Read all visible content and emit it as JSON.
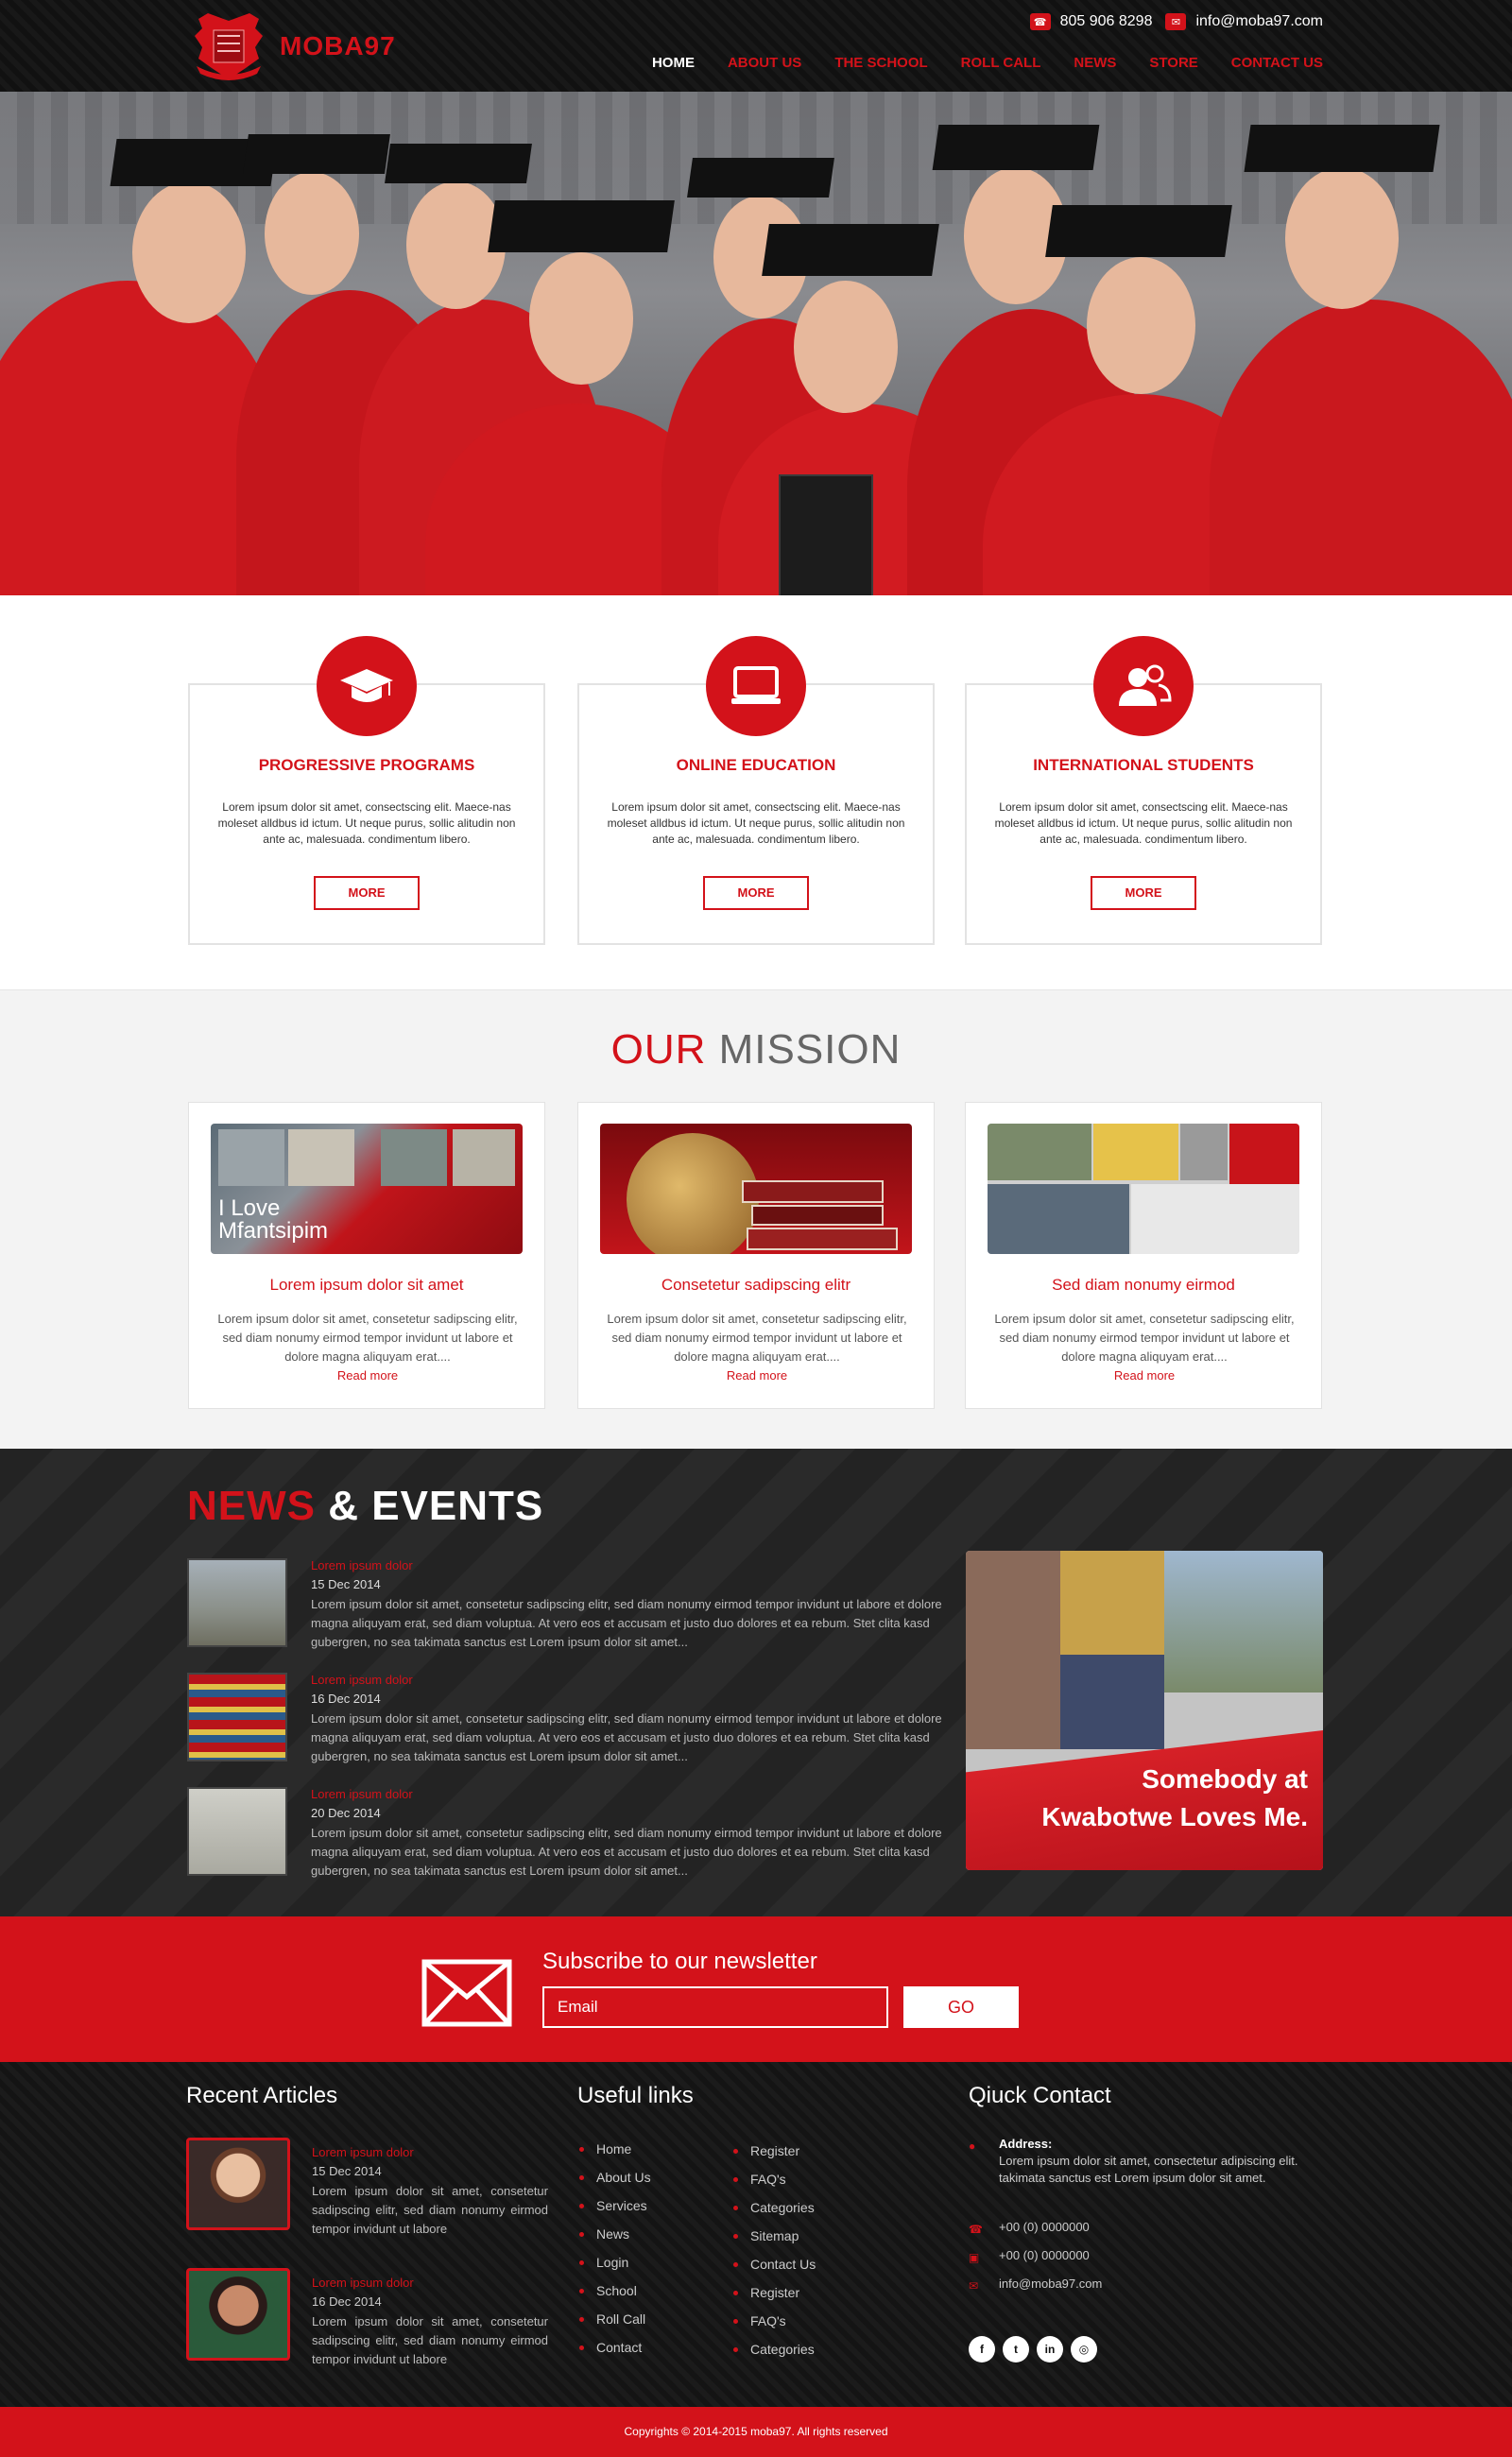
{
  "header": {
    "logo_text": "MOBA97",
    "phone": "805 906 8298",
    "email": "info@moba97.com",
    "nav": [
      "HOME",
      "ABOUT US",
      "THE SCHOOL",
      "ROLL CALL",
      "NEWS",
      "STORE",
      "CONTACT US"
    ],
    "active_nav": "HOME"
  },
  "features": [
    {
      "title": "PROGRESSIVE PROGRAMS",
      "icon": "graduation-cap-icon",
      "text": "Lorem ipsum dolor sit amet, consectscing elit. Maece-nas moleset alldbus id ictum. Ut neque purus, sollic alitudin non ante ac, malesuada. condimentum libero.",
      "button": "MORE"
    },
    {
      "title": "ONLINE EDUCATION",
      "icon": "monitor-icon",
      "text": "Lorem ipsum dolor sit amet, consectscing elit. Maece-nas moleset alldbus id ictum. Ut neque purus, sollic alitudin non ante ac, malesuada. condimentum libero.",
      "button": "MORE"
    },
    {
      "title": "INTERNATIONAL STUDENTS",
      "icon": "users-icon",
      "text": "Lorem ipsum dolor sit amet, consectscing elit. Maece-nas moleset alldbus id ictum. Ut neque purus, sollic alitudin non ante ac, malesuada. condimentum libero.",
      "button": "MORE"
    }
  ],
  "mission": {
    "title_red": "OUR",
    "title_rest": " MISSION",
    "cards": [
      {
        "image_caption": "I Love Mfantsipim",
        "title": "Lorem ipsum dolor sit amet",
        "text": "Lorem ipsum dolor sit amet, consetetur sadipscing elitr, sed diam nonumy eirmod tempor invidunt ut labore et dolore magna aliquyam erat....",
        "more": "Read more"
      },
      {
        "image_caption": "",
        "title": "Consetetur sadipscing elitr",
        "text": "Lorem ipsum dolor sit amet, consetetur sadipscing elitr, sed diam nonumy eirmod tempor invidunt ut labore et dolore magna aliquyam erat....",
        "more": "Read more"
      },
      {
        "image_caption": "",
        "title": "Sed diam nonumy eirmod",
        "text": "Lorem ipsum dolor sit amet, consetetur sadipscing elitr, sed diam nonumy eirmod tempor invidunt ut labore et dolore magna aliquyam erat....",
        "more": "Read more"
      }
    ]
  },
  "news": {
    "title_red": "NEWS",
    "title_rest": " & EVENTS",
    "items": [
      {
        "title": "Lorem ipsum dolor",
        "date": "15 Dec 2014",
        "text": "Lorem ipsum dolor sit amet, consetetur sadipscing elitr, sed diam nonumy eirmod tempor invidunt ut labore et dolore magna aliquyam erat, sed diam voluptua. At vero eos et accusam et justo duo dolores et ea rebum. Stet clita kasd gubergren, no sea takimata sanctus est Lorem ipsum dolor sit amet..."
      },
      {
        "title": "Lorem ipsum dolor",
        "date": "16 Dec 2014",
        "text": "Lorem ipsum dolor sit amet, consetetur sadipscing elitr, sed diam nonumy eirmod tempor invidunt ut labore et dolore magna aliquyam erat, sed diam voluptua. At vero eos et accusam et justo duo dolores et ea rebum. Stet clita kasd gubergren, no sea takimata sanctus est Lorem ipsum dolor sit amet..."
      },
      {
        "title": "Lorem ipsum dolor",
        "date": "20 Dec 2014",
        "text": "Lorem ipsum dolor sit amet, consetetur sadipscing elitr, sed diam nonumy eirmod tempor invidunt ut labore et dolore magna aliquyam erat, sed diam voluptua. At vero eos et accusam et justo duo dolores et ea rebum. Stet clita kasd gubergren, no sea takimata sanctus est Lorem ipsum dolor sit amet..."
      }
    ],
    "banner_line1": "Somebody at",
    "banner_line2": "Kwabotwe Loves Me."
  },
  "newsletter": {
    "title": "Subscribe to our newsletter",
    "placeholder": "Email",
    "button": "GO"
  },
  "footer": {
    "recent_title": "Recent Articles",
    "articles": [
      {
        "title": "Lorem ipsum dolor",
        "date": "15 Dec 2014",
        "text": "Lorem ipsum dolor sit amet, consetetur sadipscing elitr, sed diam nonumy eirmod tempor invidunt ut labore"
      },
      {
        "title": "Lorem ipsum dolor",
        "date": "16 Dec 2014",
        "text": "Lorem ipsum dolor sit amet, consetetur sadipscing elitr, sed diam nonumy eirmod tempor invidunt ut labore"
      }
    ],
    "links_title": "Useful links",
    "links_col1": [
      "Home",
      "About Us",
      "Services",
      "News",
      "Login",
      "School",
      "Roll Call",
      "Contact"
    ],
    "links_col2": [
      "Register",
      "FAQ's",
      "Categories",
      "Sitemap",
      "Contact Us",
      "Register",
      "FAQ's",
      "Categories"
    ],
    "contact_title": "Qiuck Contact",
    "address_label": "Address:",
    "address": "Lorem ipsum dolor sit amet, consectetur adipiscing elit. takimata sanctus est Lorem ipsum dolor sit amet.",
    "phone": "+00 (0) 0000000",
    "fax": "+00 (0) 0000000",
    "email": "info@moba97.com",
    "socials": [
      "f",
      "t",
      "in",
      "ig"
    ]
  },
  "copyright": "Copyrights © 2014-2015 moba97. All rights reserved",
  "colors": {
    "accent": "#d3121a",
    "dark": "#1a1a1a"
  }
}
